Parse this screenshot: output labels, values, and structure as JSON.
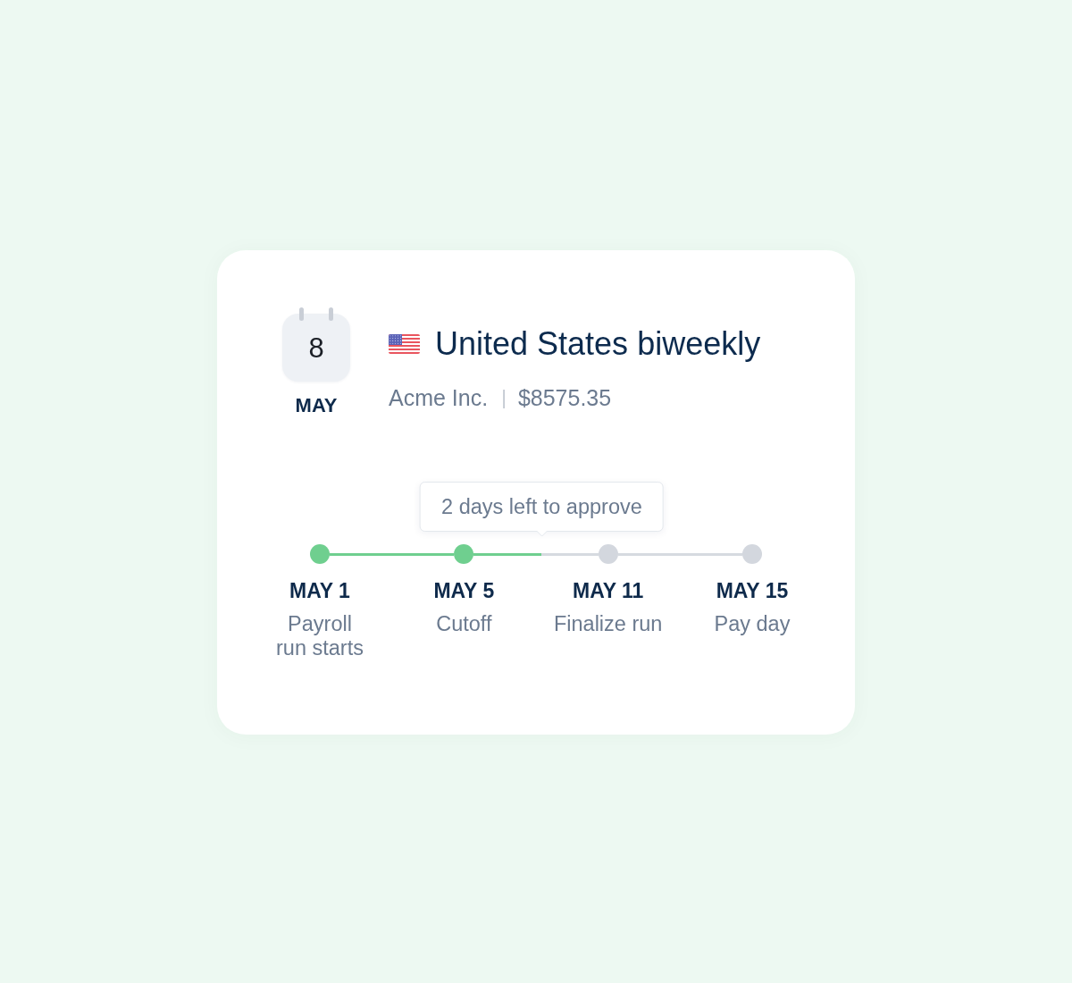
{
  "calendar": {
    "day": "8",
    "month": "MAY"
  },
  "schedule": {
    "title": "United States biweekly",
    "company": "Acme Inc.",
    "separator": "|",
    "amount": "$8575.35"
  },
  "timeline": {
    "tooltip": "2 days left to approve",
    "milestones": [
      {
        "date": "MAY 1",
        "label": "Payroll\nrun starts",
        "done": true
      },
      {
        "date": "MAY 5",
        "label": "Cutoff",
        "done": true
      },
      {
        "date": "MAY 11",
        "label": "Finalize run",
        "done": false
      },
      {
        "date": "MAY 15",
        "label": "Pay day",
        "done": false
      }
    ],
    "connectors": [
      {
        "level": 1
      },
      {
        "level": 0.54
      },
      {
        "level": 0
      }
    ]
  }
}
